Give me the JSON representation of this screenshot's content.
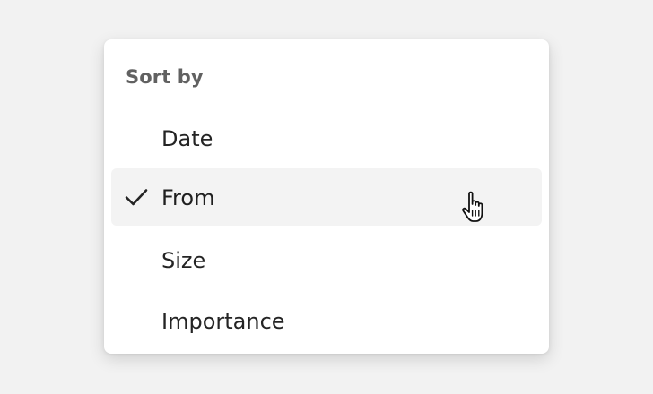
{
  "menu": {
    "header": "Sort by",
    "items": [
      {
        "label": "Date",
        "checked": false
      },
      {
        "label": "From",
        "checked": true
      },
      {
        "label": "Size",
        "checked": false
      },
      {
        "label": "Importance",
        "checked": false
      }
    ]
  },
  "icons": {
    "check": "checkmark-icon",
    "cursor": "hand-pointer-cursor-icon"
  },
  "colors": {
    "background": "#f2f2f2",
    "menu_background": "#ffffff",
    "selected_background": "#f3f3f3",
    "header_text": "#616161",
    "item_text": "#242424"
  }
}
